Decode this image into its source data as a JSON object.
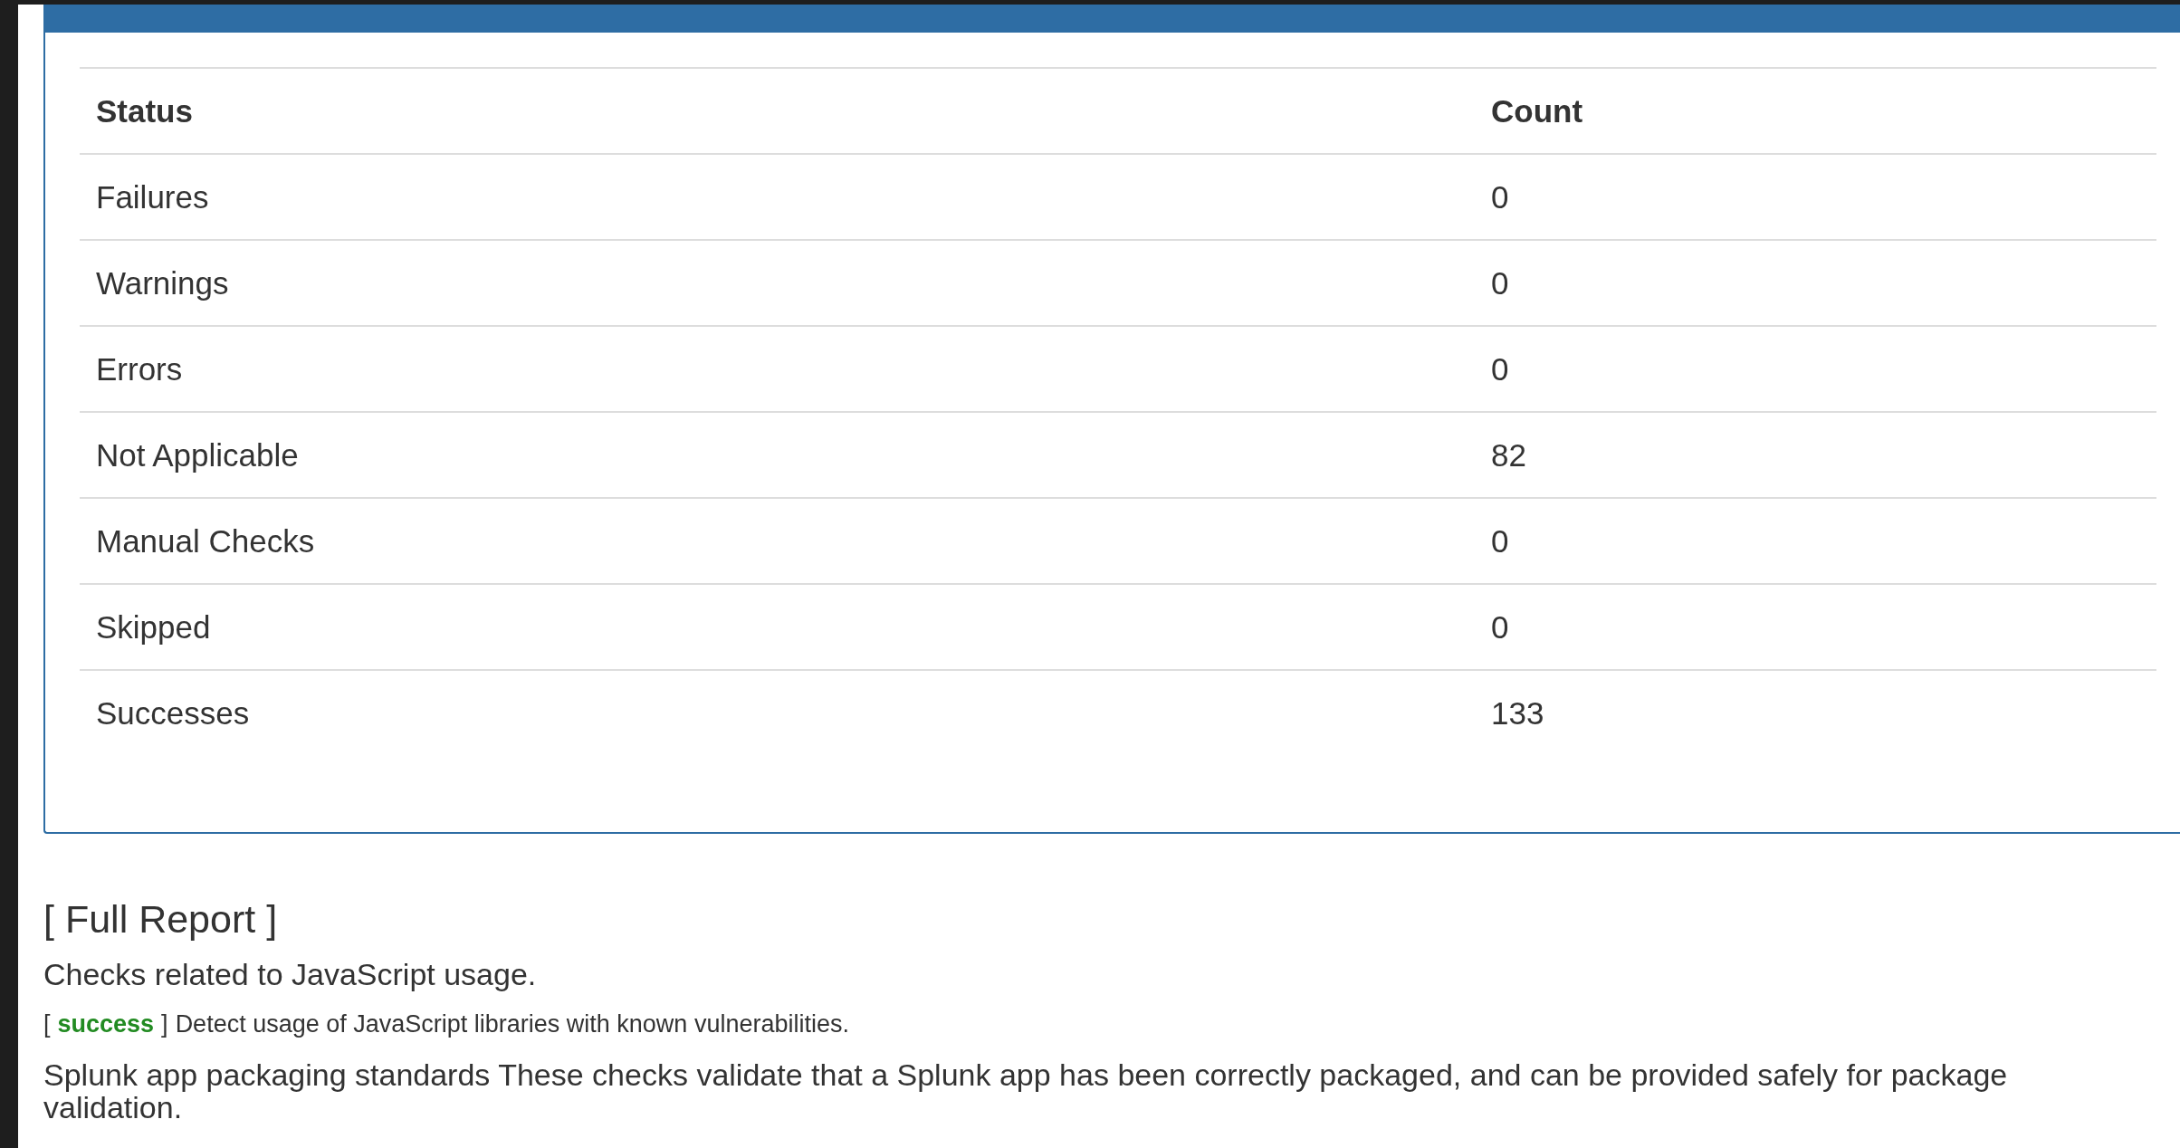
{
  "summary_table": {
    "columns": [
      "Status",
      "Count"
    ],
    "rows": [
      {
        "status": "Failures",
        "count": "0"
      },
      {
        "status": "Warnings",
        "count": "0"
      },
      {
        "status": "Errors",
        "count": "0"
      },
      {
        "status": "Not Applicable",
        "count": "82"
      },
      {
        "status": "Manual Checks",
        "count": "0"
      },
      {
        "status": "Skipped",
        "count": "0"
      },
      {
        "status": "Successes",
        "count": "133"
      }
    ]
  },
  "report": {
    "title": "[ Full Report ]",
    "sections": [
      {
        "heading": "Checks related to JavaScript usage.",
        "checks": [
          {
            "open": "[",
            "result": "success",
            "close": "]",
            "color": "#228b22",
            "description": "Detect usage of JavaScript libraries with known vulnerabilities."
          }
        ]
      },
      {
        "heading": "Splunk app packaging standards These checks validate that a Splunk app has been correctly packaged, and can be provided safely for package validation."
      }
    ]
  }
}
